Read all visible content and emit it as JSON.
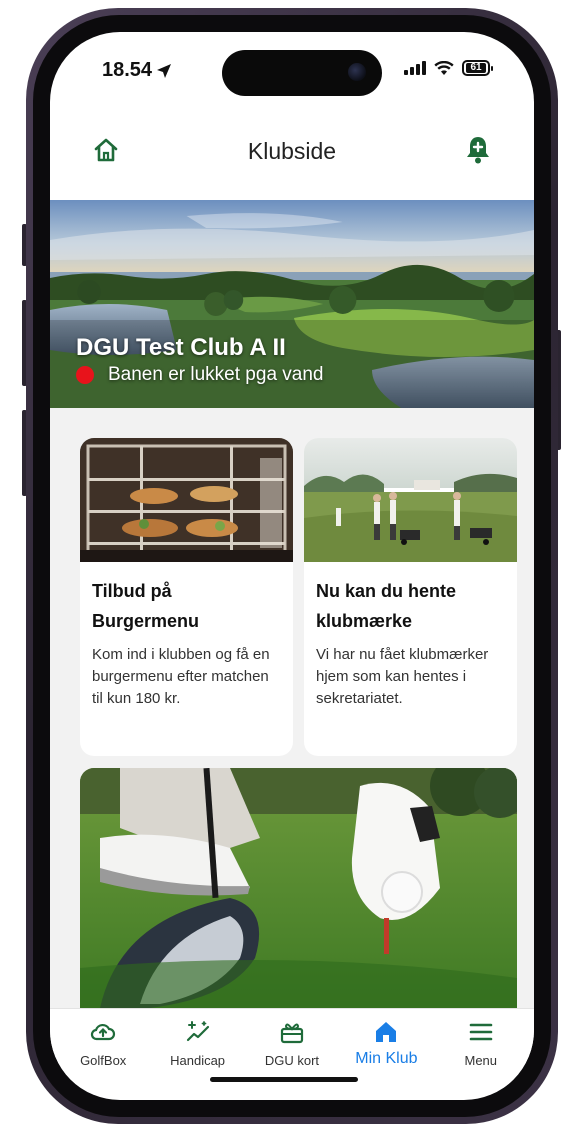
{
  "status_bar": {
    "time": "18.54",
    "battery": "61"
  },
  "header": {
    "title": "Klubside",
    "home_icon": "home-icon",
    "bell_icon": "bell-add-icon"
  },
  "hero": {
    "club_name": "DGU Test Club A II",
    "course_status": "Banen er lukket pga vand",
    "status_color": "#e8131b"
  },
  "cards": [
    {
      "title": "Tilbud på Burgermenu",
      "text": "Kom ind i klubben og få en burgermenu efter matchen til kun 180 kr."
    },
    {
      "title": "Nu kan du hente klubmærke",
      "text": "Vi har nu fået klubmærker hjem som kan hentes i sekretariatet."
    }
  ],
  "tabbar": {
    "items": [
      {
        "label": "GolfBox",
        "icon": "cloud-upload-icon"
      },
      {
        "label": "Handicap",
        "icon": "sparkle-trend-icon"
      },
      {
        "label": "DGU kort",
        "icon": "gift-card-icon"
      },
      {
        "label": "Min Klub",
        "icon": "home-icon"
      },
      {
        "label": "Menu",
        "icon": "hamburger-icon"
      }
    ],
    "active": "Min Klub"
  },
  "colors": {
    "brand_green": "#1f6b3a",
    "active_blue": "#1a7ee6"
  }
}
